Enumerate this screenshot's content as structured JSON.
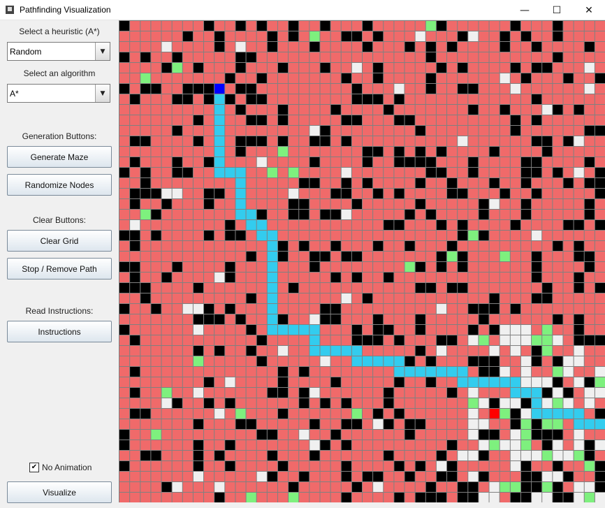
{
  "window": {
    "title": "Pathfinding Visualization"
  },
  "titlebar_buttons": [
    {
      "name": "minimize-button",
      "glyph": "—"
    },
    {
      "name": "maximize-button",
      "glyph": "☐"
    },
    {
      "name": "close-button",
      "glyph": "✕"
    }
  ],
  "sidebar": {
    "heuristic_label": "Select a heuristic (A*)",
    "heuristic_value": "Random",
    "algorithm_label": "Select an algorithm",
    "algorithm_value": "A*",
    "generation_label": "Generation Buttons:",
    "generate_maze": "Generate Maze",
    "randomize_nodes": "Randomize Nodes",
    "clear_label": "Clear Buttons:",
    "clear_grid": "Clear Grid",
    "stop_remove_path": "Stop / Remove Path",
    "instructions_label": "Read Instructions:",
    "instructions": "Instructions",
    "no_animation": "No Animation",
    "no_animation_checked": true,
    "visualize": "Visualize"
  },
  "grid": {
    "cols": 46,
    "rows": 46,
    "colors": {
      "wall": "#000000",
      "visited": "#f06a6a",
      "open": "#f0f0f0",
      "frontier": "#7ef07e",
      "path": "#33ccee",
      "start": "#0000ff",
      "end": "#ff0000"
    },
    "start": [
      6,
      9
    ],
    "end": [
      37,
      35
    ],
    "path": [
      [
        7,
        9
      ],
      [
        8,
        9
      ],
      [
        9,
        9
      ],
      [
        10,
        9
      ],
      [
        11,
        9
      ],
      [
        12,
        9
      ],
      [
        13,
        9
      ],
      [
        14,
        9
      ],
      [
        14,
        10
      ],
      [
        14,
        11
      ],
      [
        15,
        11
      ],
      [
        16,
        11
      ],
      [
        17,
        11
      ],
      [
        18,
        11
      ],
      [
        18,
        12
      ],
      [
        19,
        12
      ],
      [
        19,
        13
      ],
      [
        20,
        13
      ],
      [
        20,
        14
      ],
      [
        21,
        14
      ],
      [
        22,
        14
      ],
      [
        23,
        14
      ],
      [
        24,
        14
      ],
      [
        25,
        14
      ],
      [
        26,
        14
      ],
      [
        27,
        14
      ],
      [
        28,
        14
      ],
      [
        29,
        14
      ],
      [
        29,
        15
      ],
      [
        29,
        16
      ],
      [
        29,
        17
      ],
      [
        29,
        18
      ],
      [
        30,
        18
      ],
      [
        31,
        18
      ],
      [
        31,
        19
      ],
      [
        31,
        20
      ],
      [
        31,
        21
      ],
      [
        31,
        22
      ],
      [
        32,
        22
      ],
      [
        32,
        23
      ],
      [
        32,
        24
      ],
      [
        32,
        25
      ],
      [
        32,
        26
      ],
      [
        33,
        26
      ],
      [
        33,
        27
      ],
      [
        33,
        28
      ],
      [
        33,
        29
      ],
      [
        33,
        30
      ],
      [
        33,
        31
      ],
      [
        33,
        32
      ],
      [
        34,
        32
      ],
      [
        34,
        33
      ],
      [
        34,
        34
      ],
      [
        34,
        35
      ],
      [
        34,
        36
      ],
      [
        34,
        37
      ],
      [
        35,
        37
      ],
      [
        35,
        38
      ],
      [
        35,
        39
      ],
      [
        36,
        39
      ],
      [
        37,
        39
      ],
      [
        37,
        40
      ],
      [
        37,
        41
      ],
      [
        37,
        42
      ],
      [
        37,
        43
      ],
      [
        38,
        43
      ],
      [
        38,
        44
      ],
      [
        38,
        45
      ],
      [
        38,
        46
      ],
      [
        38,
        47
      ],
      [
        38,
        48
      ],
      [
        37,
        48
      ],
      [
        37,
        49
      ],
      [
        37,
        50
      ],
      [
        37,
        51
      ]
    ]
  }
}
